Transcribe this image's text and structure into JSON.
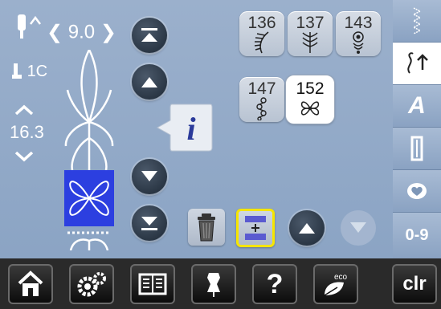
{
  "status": {
    "stitch_width": "9.0",
    "presser_foot": "1C",
    "stitch_length": "16.3"
  },
  "stitch_tiles": [
    {
      "number": "136",
      "selected": false
    },
    {
      "number": "137",
      "selected": false
    },
    {
      "number": "143",
      "selected": false
    },
    {
      "number": "147",
      "selected": false
    },
    {
      "number": "152",
      "selected": true
    }
  ],
  "sidebar": {
    "tabs": [
      {
        "icon": "running-stitch-icon",
        "label": ""
      },
      {
        "icon": "decorative-stitch-icon",
        "label": ""
      },
      {
        "icon": "alphabet-icon",
        "label": "A"
      },
      {
        "icon": "buttonhole-icon",
        "label": ""
      },
      {
        "icon": "heart-icon",
        "label": ""
      },
      {
        "icon": "numeric-icon",
        "label": "0-9"
      }
    ]
  },
  "toolbar": {
    "clr_label": "clr",
    "eco_label": "eco",
    "help_label": "?"
  },
  "colors": {
    "background": "#8ba4c4",
    "preview_highlight": "#2c3fe0",
    "selected_border": "#f5e500",
    "info_icon": "#2a3a9a"
  }
}
